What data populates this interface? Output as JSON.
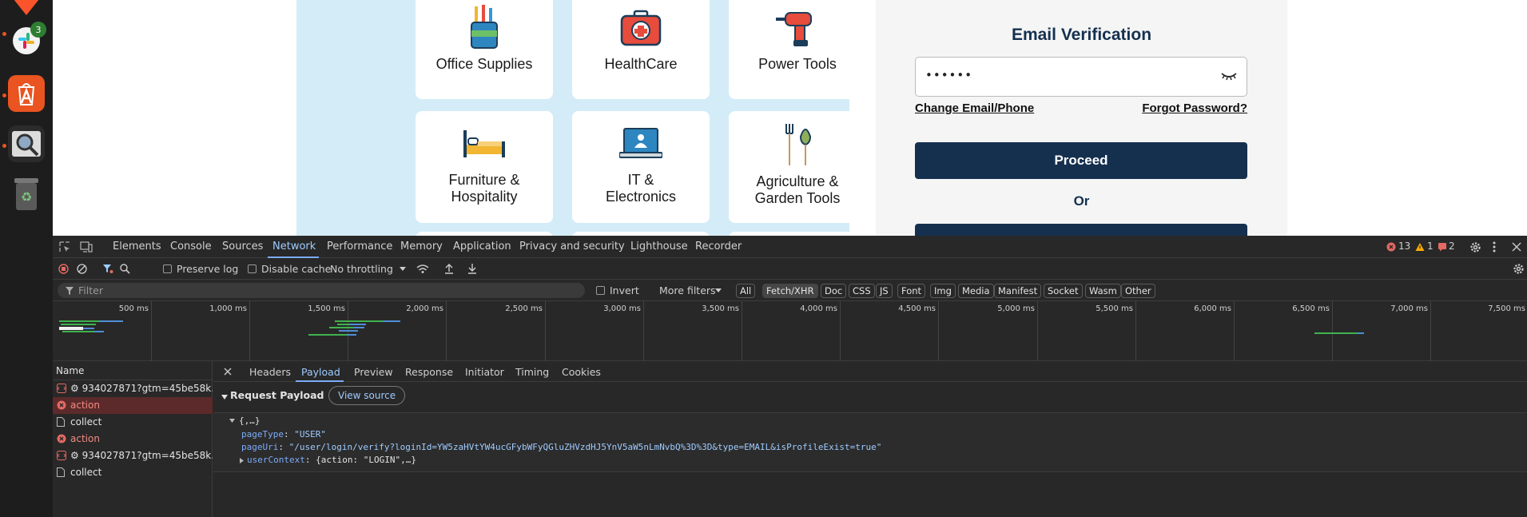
{
  "dock": {
    "badge": "3",
    "colors": {
      "brave": "#fb542b",
      "store": "#e95420",
      "trash": "#5a5a5a"
    }
  },
  "page": {
    "categories": [
      {
        "label": "Office Supplies"
      },
      {
        "label": "HealthCare"
      },
      {
        "label": "Power Tools"
      },
      {
        "label_line1": "Furniture &",
        "label_line2": "Hospitality"
      },
      {
        "label_line1": "IT &",
        "label_line2": "Electronics"
      },
      {
        "label_line1": "Agriculture &",
        "label_line2": "Garden Tools"
      }
    ],
    "login": {
      "title": "Email Verification",
      "password_value": "••••••",
      "change_link": "Change Email/Phone",
      "forgot_link": "Forgot Password?",
      "proceed": "Proceed",
      "or": "Or"
    }
  },
  "devtools": {
    "tabs": [
      "Elements",
      "Console",
      "Sources",
      "Network",
      "Performance",
      "Memory",
      "Application",
      "Privacy and security",
      "Lighthouse",
      "Recorder"
    ],
    "active_tab": "Network",
    "status": {
      "errors": "13",
      "warnings": "1",
      "issues": "2"
    },
    "toolbar": {
      "preserve_log": "Preserve log",
      "disable_cache": "Disable cache",
      "throttling": "No throttling"
    },
    "filter": {
      "placeholder": "Filter",
      "invert": "Invert",
      "more_filters": "More filters",
      "types": [
        "All",
        "Fetch/XHR",
        "Doc",
        "CSS",
        "JS",
        "Font",
        "Img",
        "Media",
        "Manifest",
        "Socket",
        "Wasm",
        "Other"
      ],
      "active_type": "Fetch/XHR"
    },
    "timeline": {
      "ticks": [
        "500 ms",
        "1,000 ms",
        "1,500 ms",
        "2,000 ms",
        "2,500 ms",
        "3,000 ms",
        "3,500 ms",
        "4,000 ms",
        "4,500 ms",
        "5,000 ms",
        "5,500 ms",
        "6,000 ms",
        "6,500 ms",
        "7,000 ms",
        "7,500 ms"
      ]
    },
    "requests": {
      "header": "Name",
      "items": [
        {
          "name": "⚙ 934027871?gtm=45be58k...",
          "type": "script"
        },
        {
          "name": "action",
          "type": "error"
        },
        {
          "name": "collect",
          "type": "doc"
        },
        {
          "name": "action",
          "type": "error"
        },
        {
          "name": "⚙ 934027871?gtm=45be58k...",
          "type": "script"
        },
        {
          "name": "collect",
          "type": "doc"
        }
      ]
    },
    "detail": {
      "tabs": [
        "Headers",
        "Payload",
        "Preview",
        "Response",
        "Initiator",
        "Timing",
        "Cookies"
      ],
      "active_tab": "Payload",
      "section": "Request Payload",
      "view_source": "View source",
      "payload": {
        "root": "{,…}",
        "page_type_key": "pageType",
        "page_type_val": "\"USER\"",
        "page_uri_key": "pageUri",
        "page_uri_val": "\"/user/login/verify?loginId=YW5zaHVtYW4ucGFybWFyQGluZHVzdHJ5YnV5aW5nLmNvbQ%3D%3D&type=EMAIL&isProfileExist=true\"",
        "user_context_key": "userContext",
        "user_context_val": "{action: \"LOGIN\",…}"
      }
    }
  }
}
